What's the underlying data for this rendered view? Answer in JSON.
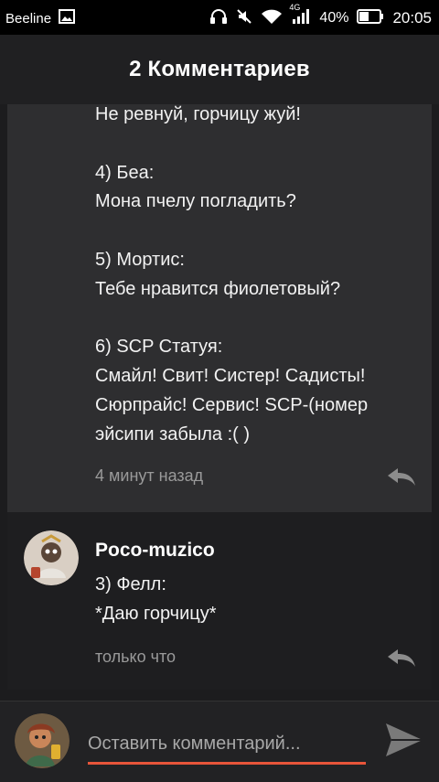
{
  "status_bar": {
    "carrier": "Beeline",
    "network_type": "4G",
    "battery_percent": "40%",
    "time": "20:05"
  },
  "header": {
    "title": "2 Комментариев"
  },
  "comments": [
    {
      "text": "Не ревнуй, горчицу жуй!\n\n4) Беа:\nМона пчелу погладить?\n\n5) Мортис:\nТебе нравится фиолетовый?\n\n6) SCP Статуя:\nСмайл! Свит! Систер! Садисты! Сюрпрайс! Сервис! SCP-(номер эйсипи забыла :( )",
      "time": "4 минут назад"
    },
    {
      "author": "Poco-muzico",
      "text": "3) Фелл:\n*Даю горчицу*",
      "time": "только что"
    }
  ],
  "input": {
    "placeholder": "Оставить комментарий..."
  },
  "colors": {
    "accent": "#e8553a",
    "background": "#1c1c1e",
    "card": "#2e2e30"
  }
}
